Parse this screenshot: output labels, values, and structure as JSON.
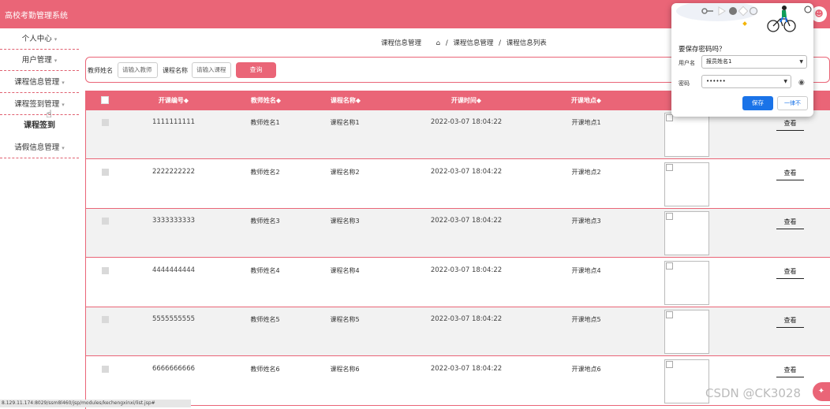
{
  "app": {
    "title": "高校考勤管理系统",
    "user_icon": "user-icon"
  },
  "sidebar": {
    "items": [
      {
        "label": "个人中心",
        "caret": "▾"
      },
      {
        "label": "用户管理",
        "caret": "▾"
      },
      {
        "label": "课程信息管理",
        "caret": "▾"
      },
      {
        "label": "课程签到管理",
        "caret": "▾"
      },
      {
        "label": "课程签到",
        "caret": ""
      },
      {
        "label": "请假信息管理",
        "caret": "▾"
      }
    ]
  },
  "breadcrumb": {
    "section": "课程信息管理",
    "home_icon": "⌂",
    "sep": "/",
    "level1": "课程信息管理",
    "level2": "课程信息列表"
  },
  "search": {
    "teacher_label": "教师姓名",
    "teacher_placeholder": "请输入教师",
    "course_label": "课程名称",
    "course_placeholder": "请输入课程",
    "button": "查询"
  },
  "table": {
    "headers": [
      "开课编号◆",
      "教师姓名◆",
      "课程名称◆",
      "开课时间◆",
      "开课地点◆"
    ],
    "rows": [
      {
        "id": "1111111111",
        "teacher": "教师姓名1",
        "course": "课程名称1",
        "time": "2022-03-07 18:04:22",
        "place": "开课地点1",
        "action": "查看"
      },
      {
        "id": "2222222222",
        "teacher": "教师姓名2",
        "course": "课程名称2",
        "time": "2022-03-07 18:04:22",
        "place": "开课地点2",
        "action": "查看"
      },
      {
        "id": "3333333333",
        "teacher": "教师姓名3",
        "course": "课程名称3",
        "time": "2022-03-07 18:04:22",
        "place": "开课地点3",
        "action": "查看"
      },
      {
        "id": "4444444444",
        "teacher": "教师姓名4",
        "course": "课程名称4",
        "time": "2022-03-07 18:04:22",
        "place": "开课地点4",
        "action": "查看"
      },
      {
        "id": "5555555555",
        "teacher": "教师姓名5",
        "course": "课程名称5",
        "time": "2022-03-07 18:04:22",
        "place": "开课地点5",
        "action": "查看"
      },
      {
        "id": "6666666666",
        "teacher": "教师姓名6",
        "course": "课程名称6",
        "time": "2022-03-07 18:04:22",
        "place": "开课地点6",
        "action": "查看"
      }
    ]
  },
  "password_dialog": {
    "title": "要保存密码吗？",
    "username_label": "用户名",
    "username_value": "报员姓名1",
    "password_label": "密码",
    "password_value": "••••••",
    "save_button": "保存",
    "never_button": "一律不"
  },
  "status_url": "8.129.11.174:8029/ssm8l460/jsp/modules/kechengxinxi/list.jsp#",
  "watermark": "CSDN @CK3028",
  "colors": {
    "brand": "#ea6577",
    "primary_blue": "#1a73e8"
  }
}
